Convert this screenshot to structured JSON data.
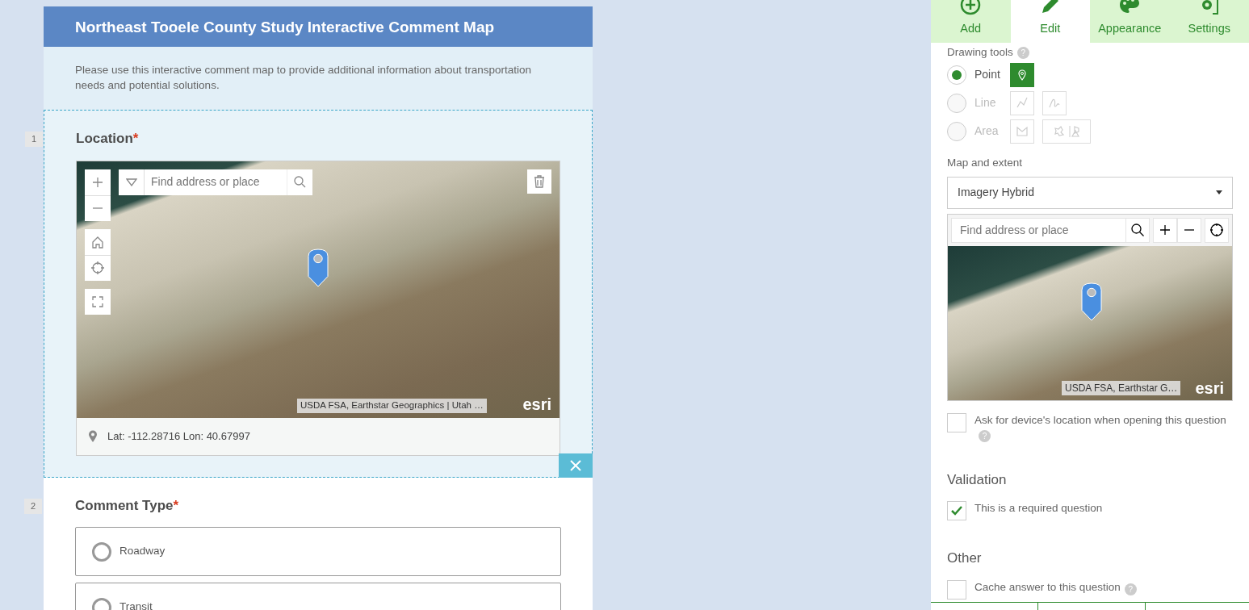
{
  "form": {
    "title": "Northeast Tooele County Study Interactive Comment Map",
    "description": "Please use this interactive comment map to provide additional information about transportation needs and potential solutions.",
    "questions": [
      {
        "number": "1",
        "label": "Location",
        "required_mark": "*",
        "selected": true,
        "kind": "map",
        "map": {
          "search_placeholder": "Find address or place",
          "attribution": "USDA FSA, Earthstar Geographics | Utah …",
          "logo": "esri",
          "coordinates": "Lat: -112.28716 Lon: 40.67997"
        }
      },
      {
        "number": "2",
        "label": "Comment Type",
        "required_mark": "*",
        "selected": false,
        "kind": "choice",
        "options": [
          {
            "label": "Roadway",
            "checked": false
          },
          {
            "label": "Transit",
            "checked": false
          }
        ]
      }
    ]
  },
  "panel": {
    "tabs": [
      {
        "label": "Add",
        "kind": "add",
        "selected": false
      },
      {
        "label": "Edit",
        "kind": "edit",
        "selected": true
      },
      {
        "label": "Appearance",
        "kind": "appearance",
        "selected": false
      },
      {
        "label": "Settings",
        "kind": "settings",
        "selected": false
      }
    ],
    "drawing_tools": {
      "label": "Drawing tools",
      "help": "?",
      "options": [
        {
          "label": "Point",
          "selected": true,
          "disabled": false,
          "tools": [
            {
              "kind": "pin",
              "active": true
            }
          ]
        },
        {
          "label": "Line",
          "selected": false,
          "disabled": true,
          "tools": [
            {
              "kind": "polyline",
              "active": false
            },
            {
              "kind": "freehand",
              "active": false
            }
          ]
        },
        {
          "label": "Area",
          "selected": false,
          "disabled": true,
          "tools": [
            {
              "kind": "polygon",
              "active": false
            },
            {
              "kind": "freehand-area",
              "active": false
            }
          ]
        }
      ]
    },
    "map_and_extent": {
      "label": "Map and extent",
      "value": "Imagery Hybrid",
      "search_placeholder": "Find address or place",
      "attribution": "USDA FSA, Earthstar G…",
      "logo": "esri"
    },
    "sections": [
      {
        "checkboxes": [
          {
            "label": "Ask for device's location when opening this question",
            "checked": false,
            "help": "?"
          }
        ]
      },
      {
        "heading": "Validation",
        "checkboxes": [
          {
            "label": "This is a required question",
            "checked": true
          }
        ]
      },
      {
        "heading": "Other",
        "checkboxes": [
          {
            "label": "Cache answer to this question",
            "checked": false,
            "help": "?"
          }
        ]
      }
    ]
  }
}
